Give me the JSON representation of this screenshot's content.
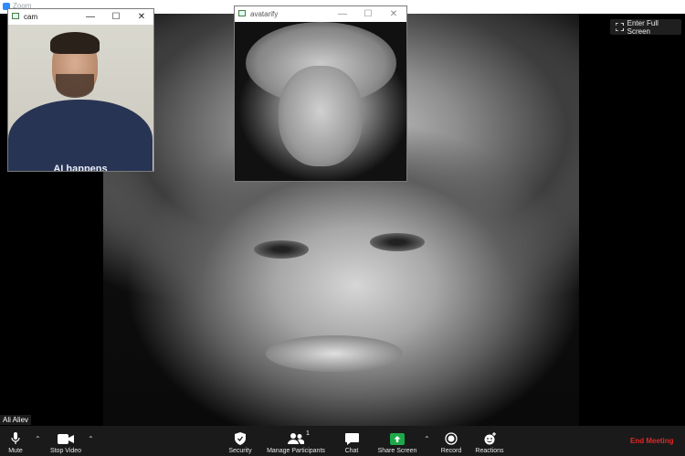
{
  "zoom": {
    "title": "Zoom"
  },
  "enter_full_screen": "Enter Full Screen",
  "cam_window": {
    "title": "cam",
    "shirt_text": "AI happens"
  },
  "avatar_window": {
    "title": "avatarify"
  },
  "window_controls": {
    "minimize": "—",
    "maximize": "☐",
    "close": "✕"
  },
  "participant_name": "Ali Aliev",
  "toolbar": {
    "mute": "Mute",
    "stop_video": "Stop Video",
    "security": "Security",
    "manage_participants": "Manage Participants",
    "participant_count": "1",
    "chat": "Chat",
    "share_screen": "Share Screen",
    "record": "Record",
    "reactions": "Reactions",
    "end_meeting": "End Meeting"
  },
  "colors": {
    "end_meeting": "#e02828",
    "share_green": "#1ea84a",
    "toolbar_bg": "#1a1a1a"
  }
}
